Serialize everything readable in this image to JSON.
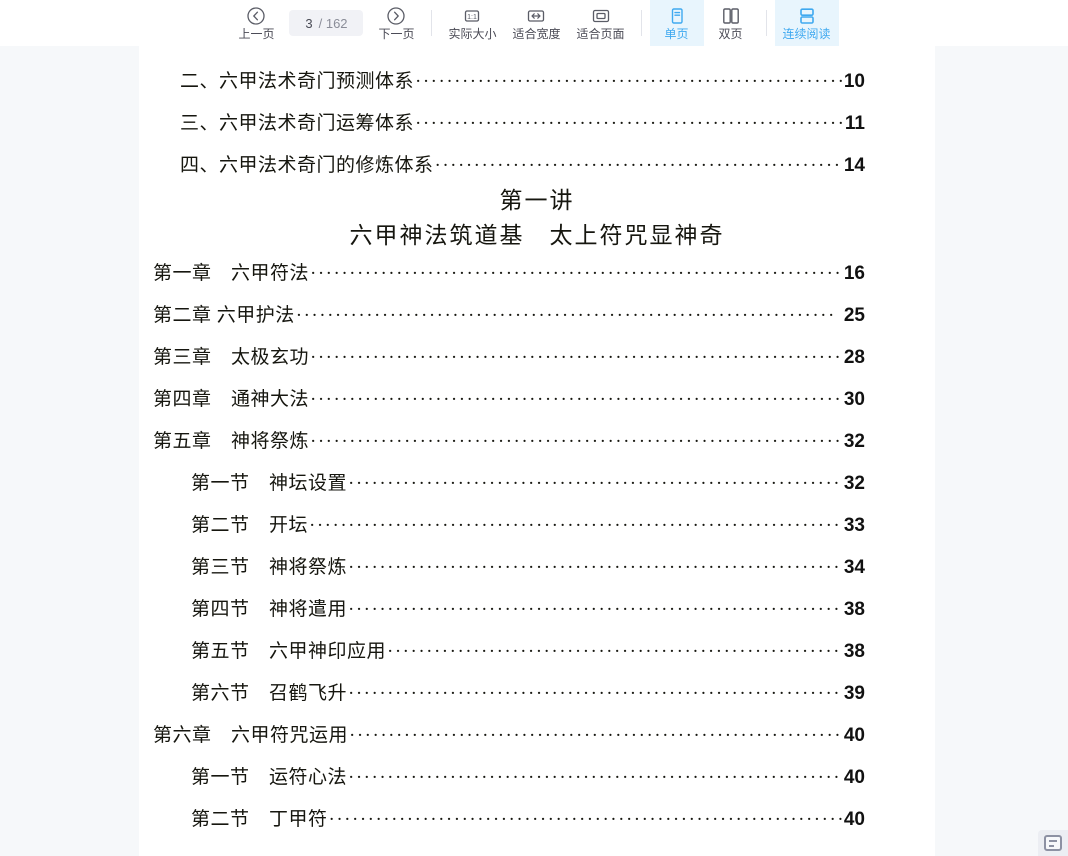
{
  "toolbar": {
    "prev_page": {
      "label": "上一页",
      "icon": "chevron-left-circle-icon"
    },
    "page_indicator": {
      "current": "3",
      "total": "/ 162",
      "value": "3 / 162"
    },
    "next_page": {
      "label": "下一页",
      "icon": "chevron-right-circle-icon"
    },
    "actual_size": {
      "label": "实际大小",
      "icon": "one-to-one-icon"
    },
    "fit_width": {
      "label": "适合宽度",
      "icon": "arrows-horizontal-icon"
    },
    "fit_page": {
      "label": "适合页面",
      "icon": "rectangle-icon"
    },
    "single_page": {
      "label": "单页",
      "icon": "single-page-icon",
      "active": true
    },
    "double_page": {
      "label": "双页",
      "icon": "double-page-icon",
      "active": false
    },
    "continuous_read": {
      "label": "连续阅读",
      "icon": "continuous-scroll-icon",
      "active": true
    },
    "accent_color": "#3fa9f0",
    "accent_bg": "#e8f5fd",
    "text_color": "#4a4a55"
  },
  "document": {
    "headings": {
      "lecture": "第一讲",
      "subtitle": "六甲神法筑道基　太上符咒显神奇"
    },
    "toc": [
      {
        "title": "二、六甲法术奇门预测体系",
        "page": "10",
        "level": "a",
        "gapped": false
      },
      {
        "title": "三、六甲法术奇门运筹体系",
        "page": "11",
        "level": "a",
        "gapped": false
      },
      {
        "title": "四、六甲法术奇门的修炼体系",
        "page": "14",
        "level": "a",
        "gapped": false
      },
      {
        "title": "第一章　六甲符法",
        "page": "16",
        "level": "b",
        "gapped": false
      },
      {
        "title": "第二章 六甲护法",
        "page": "25",
        "level": "b",
        "gapped": true
      },
      {
        "title": "第三章　太极玄功",
        "page": "28",
        "level": "b",
        "gapped": false
      },
      {
        "title": "第四章　通神大法",
        "page": "30",
        "level": "b",
        "gapped": false
      },
      {
        "title": "第五章　神将祭炼",
        "page": "32",
        "level": "b",
        "gapped": false
      },
      {
        "title": "第一节　神坛设置",
        "page": "32",
        "level": "c",
        "gapped": false
      },
      {
        "title": "第二节　开坛",
        "page": "33",
        "level": "c",
        "gapped": false
      },
      {
        "title": "第三节　神将祭炼",
        "page": "34",
        "level": "c",
        "gapped": false
      },
      {
        "title": "第四节　神将遣用",
        "page": "38",
        "level": "c",
        "gapped": false
      },
      {
        "title": "第五节　六甲神印应用",
        "page": "38",
        "level": "c",
        "gapped": false
      },
      {
        "title": "第六节　召鹤飞升",
        "page": "39",
        "level": "c",
        "gapped": false
      },
      {
        "title": "第六章　六甲符咒运用",
        "page": "40",
        "level": "b",
        "gapped": false
      },
      {
        "title": "第一节　运符心法",
        "page": "40",
        "level": "c",
        "gapped": false
      },
      {
        "title": "第二节　丁甲符",
        "page": "40",
        "level": "c",
        "gapped": false
      }
    ]
  },
  "corner": {
    "icon": "mini-panel-icon"
  }
}
